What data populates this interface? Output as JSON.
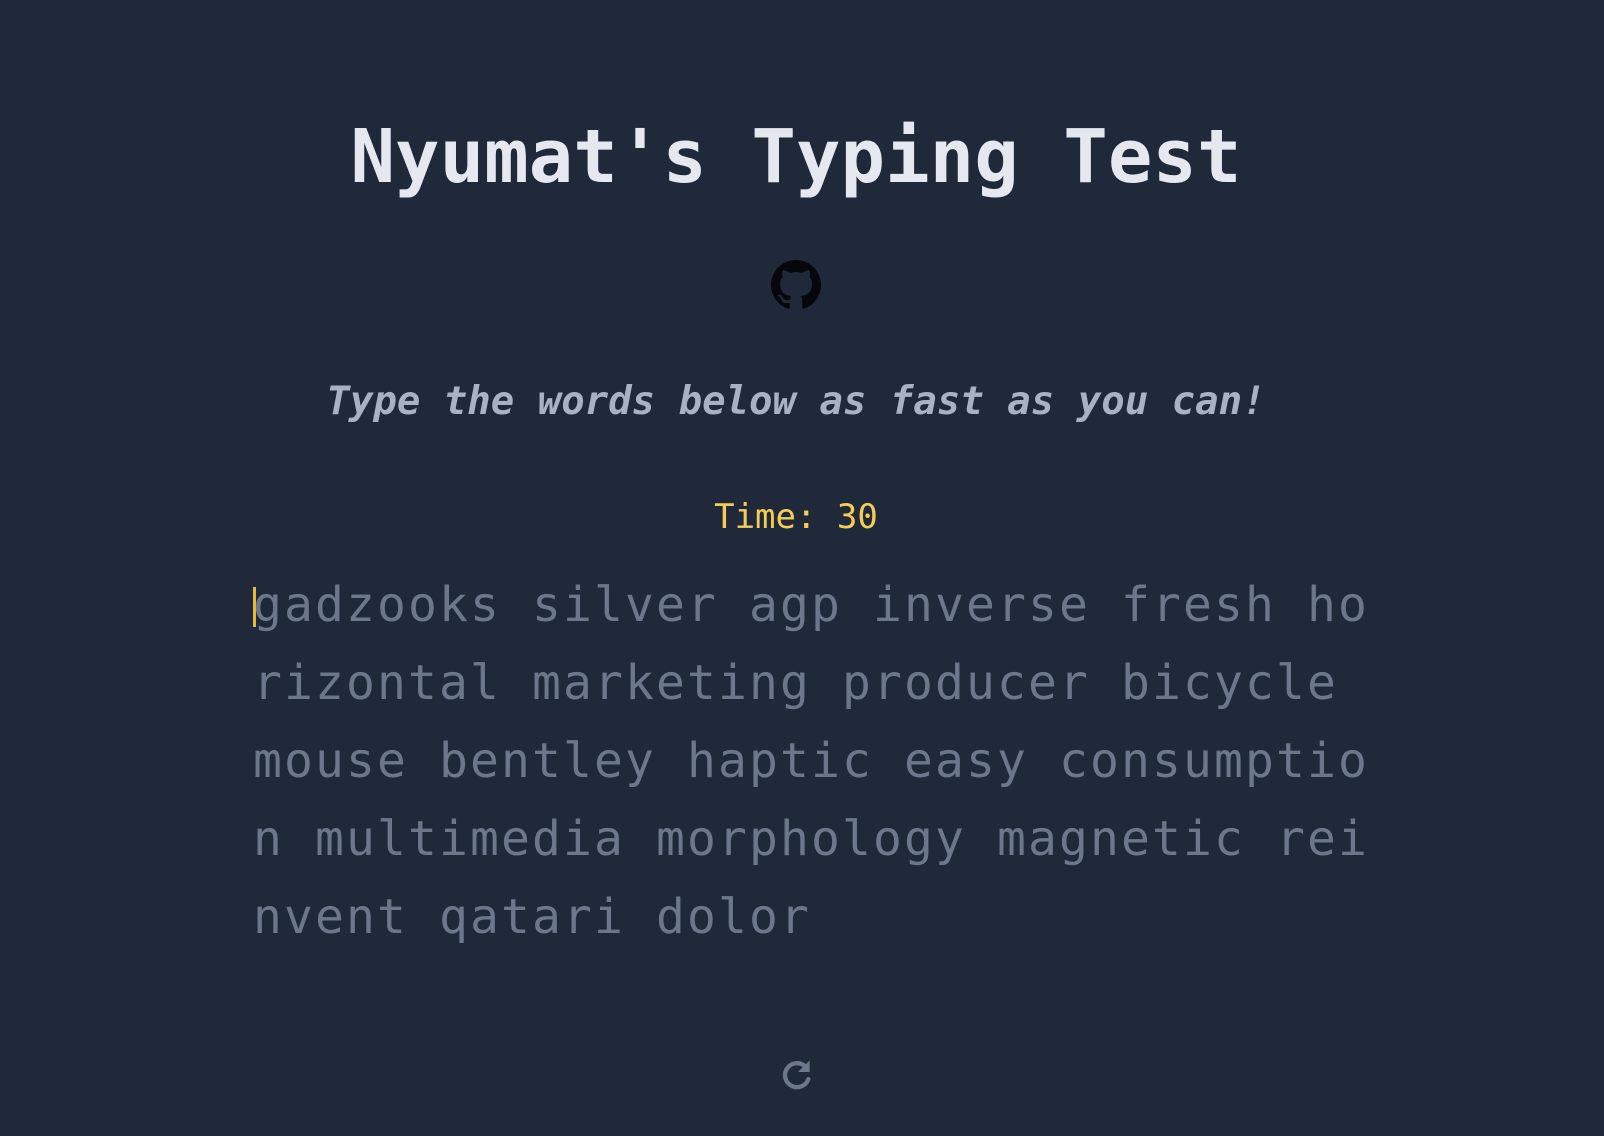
{
  "header": {
    "title": "Nyumat's Typing Test"
  },
  "links": {
    "github_icon": "github-icon"
  },
  "instructions": {
    "subtitle": "Type the words below as fast as you can!"
  },
  "timer": {
    "text": "Time: 30"
  },
  "test": {
    "words": "gadzooks silver agp inverse fresh horizontal marketing producer bicycle mouse bentley haptic easy consumption multimedia morphology magnetic reinvent qatari dolor"
  },
  "controls": {
    "reload_icon": "reload-icon"
  },
  "colors": {
    "background": "#1f293a",
    "title": "#e5e8ee",
    "subtitle": "#a9b2c3",
    "timer": "#f3cd55",
    "untyped_words": "#6c778c",
    "caret": "#e8b83e"
  }
}
